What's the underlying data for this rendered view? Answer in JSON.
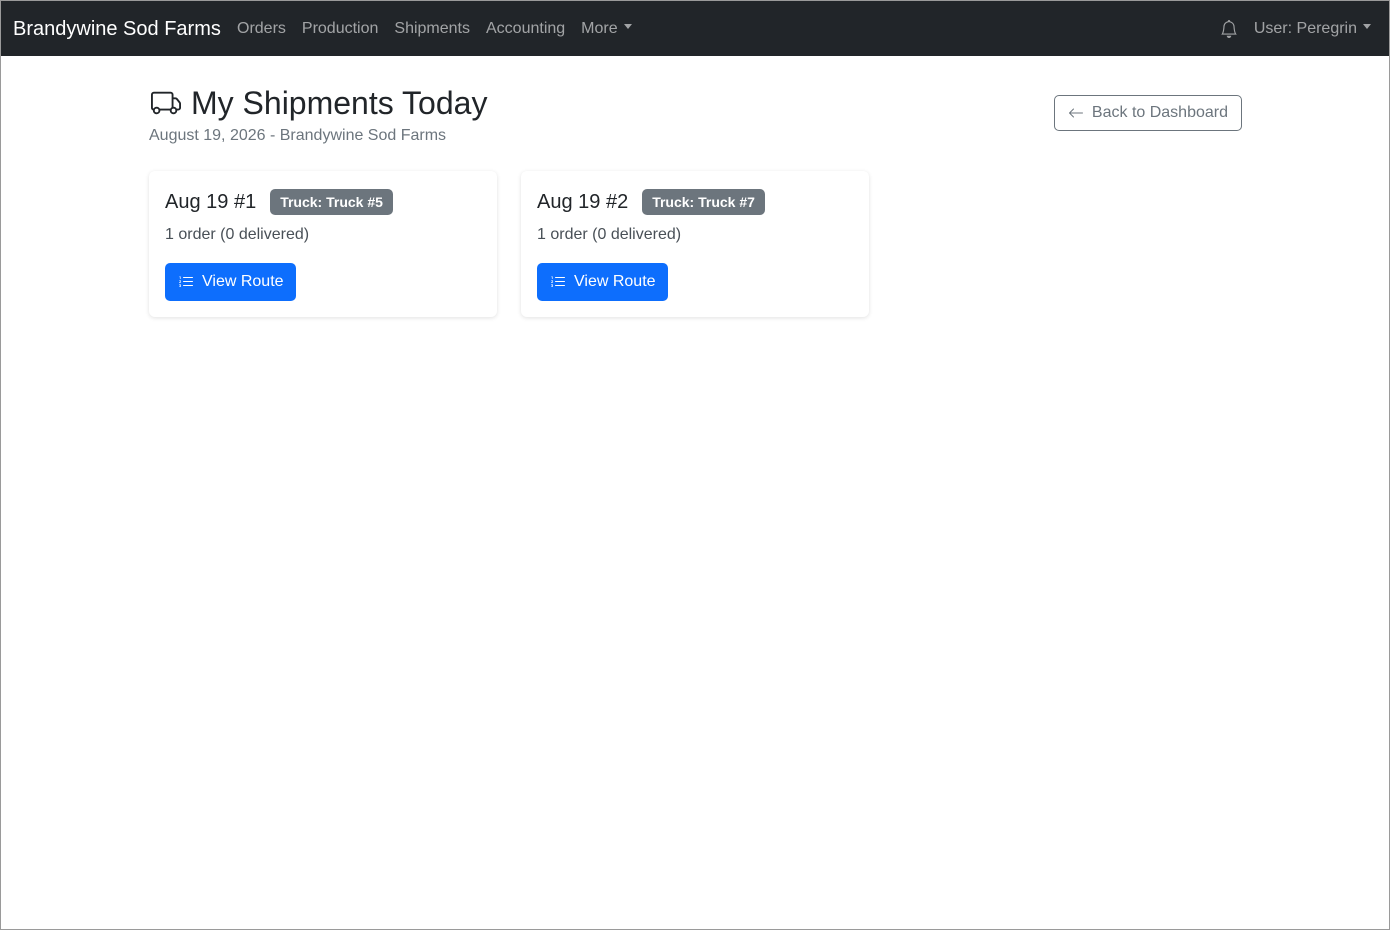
{
  "navbar": {
    "brand": "Brandywine Sod Farms",
    "links": [
      {
        "label": "Orders"
      },
      {
        "label": "Production"
      },
      {
        "label": "Shipments"
      },
      {
        "label": "Accounting"
      },
      {
        "label": "More"
      }
    ],
    "user_label": "User: Peregrin",
    "icons": {
      "notifications": "bell-icon",
      "user_dropdown": "chevron-down-icon"
    }
  },
  "header": {
    "title": "My Shipments Today",
    "subtitle": "August 19, 2026 - Brandywine Sod Farms",
    "title_icon": "truck-icon",
    "back_button": "Back to Dashboard"
  },
  "shipments": [
    {
      "title": "Aug 19 #1",
      "truck_badge": "Truck: Truck #5",
      "summary": "1 order (0 delivered)",
      "action_label": "View Route"
    },
    {
      "title": "Aug 19 #2",
      "truck_badge": "Truck: Truck #7",
      "summary": "1 order (0 delivered)",
      "action_label": "View Route"
    }
  ],
  "colors": {
    "navbar_bg": "#212529",
    "primary": "#0d6efd",
    "secondary": "#6c757d"
  }
}
